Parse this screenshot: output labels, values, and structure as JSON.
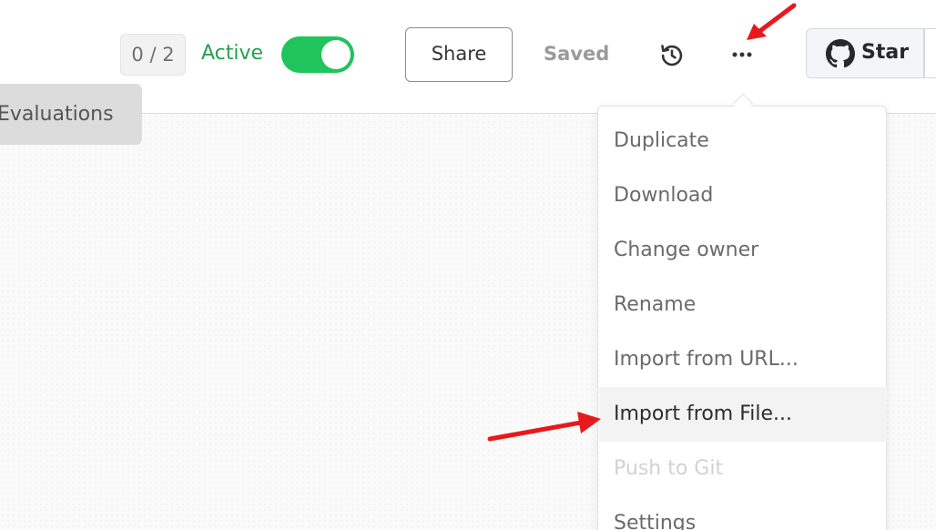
{
  "header": {
    "counter": "0 / 2",
    "active_label": "Active",
    "active_enabled": true,
    "share_label": "Share",
    "saved_label": "Saved",
    "history_icon": "history-icon",
    "more_icon": "ellipsis-icon",
    "star_label": "Star",
    "github_icon": "github-icon"
  },
  "tabs": {
    "evaluations": "Evaluations"
  },
  "menu": {
    "items": [
      {
        "label": "Duplicate",
        "state": "normal"
      },
      {
        "label": "Download",
        "state": "normal"
      },
      {
        "label": "Change owner",
        "state": "normal"
      },
      {
        "label": "Rename",
        "state": "normal"
      },
      {
        "label": "Import from URL...",
        "state": "normal"
      },
      {
        "label": "Import from File...",
        "state": "hover"
      },
      {
        "label": "Push to Git",
        "state": "disabled"
      },
      {
        "label": "Settings",
        "state": "normal"
      }
    ]
  },
  "colors": {
    "accent_green": "#1fc45a",
    "active_text": "#22a24a",
    "annotation_red": "#e8191c"
  }
}
